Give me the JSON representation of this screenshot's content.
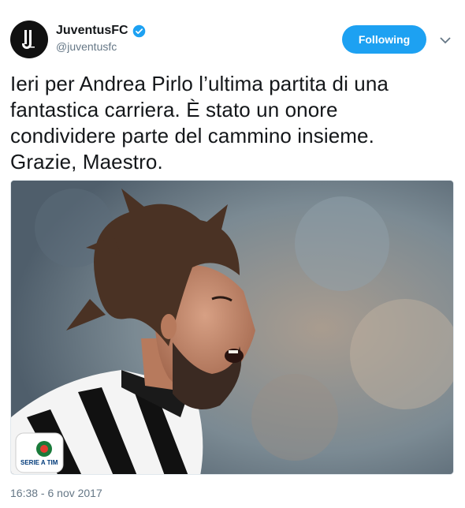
{
  "account": {
    "display_name": "JuventusFC",
    "handle": "@juventusfc",
    "verified": true,
    "avatar_icon": "juventus-logo-icon"
  },
  "follow_button": {
    "label": "Following",
    "color": "#1da1f2"
  },
  "menu": {
    "icon": "chevron-down-icon"
  },
  "tweet": {
    "text_lines": [
      "Ieri per Andrea Pirlo l’ultima partita di una",
      "fantastica carriera. È stato un onore",
      "condividere parte del cammino insieme.",
      "Grazie, Maestro."
    ],
    "timestamp": "16:38 - 6 nov 2017"
  },
  "media": {
    "badge_text": "SERIE A TIM"
  }
}
